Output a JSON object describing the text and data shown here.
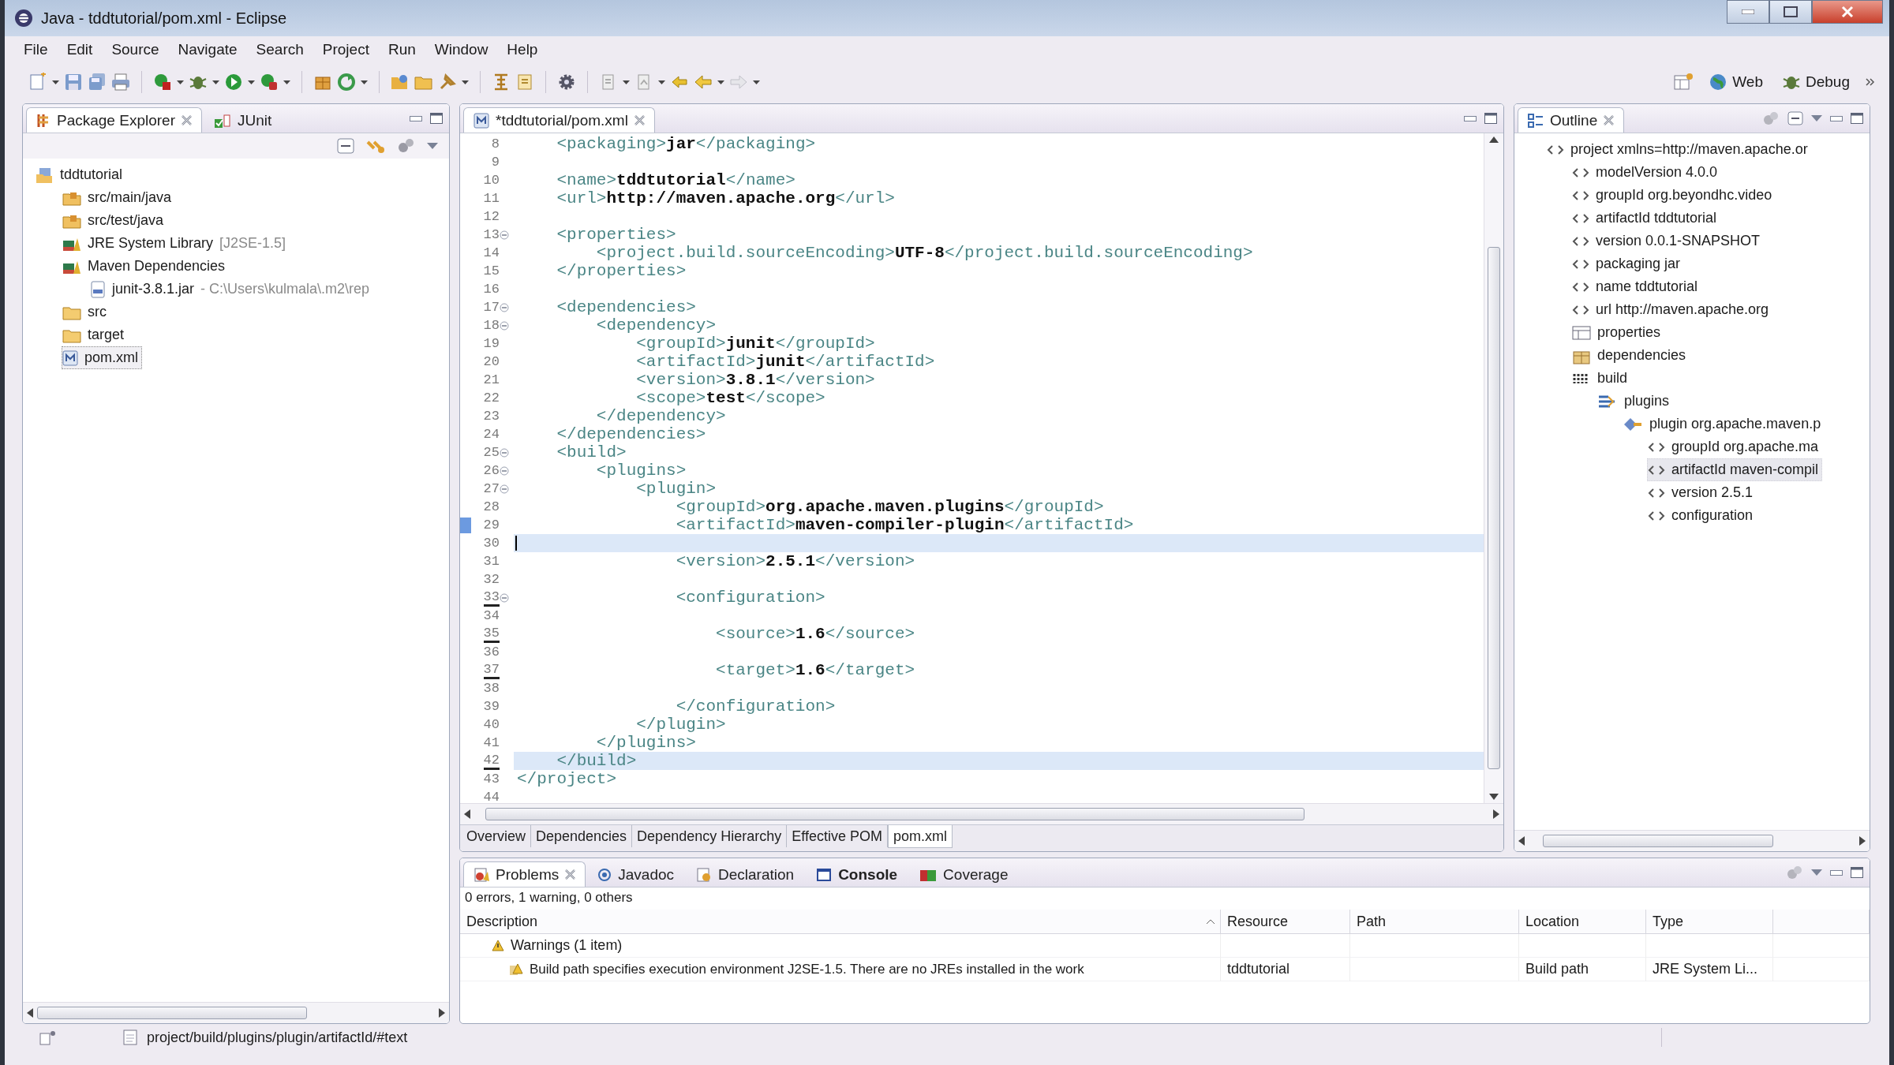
{
  "window": {
    "title": "Java - tddtutorial/pom.xml - Eclipse"
  },
  "menu": [
    "File",
    "Edit",
    "Source",
    "Navigate",
    "Search",
    "Project",
    "Run",
    "Window",
    "Help"
  ],
  "perspectives": [
    {
      "label": "Web",
      "kind": "web"
    },
    {
      "label": "Debug",
      "kind": "debug"
    }
  ],
  "package_explorer": {
    "tabs": [
      {
        "label": "Package Explorer",
        "kind": "packages",
        "selected": true
      },
      {
        "label": "JUnit",
        "kind": "junit",
        "selected": false
      }
    ],
    "tree": [
      {
        "label": "tddtutorial",
        "kind": "project",
        "selected": false,
        "children": [
          {
            "label": "src/main/java",
            "kind": "source-folder",
            "selected": false
          },
          {
            "label": "src/test/java",
            "kind": "source-folder",
            "selected": false
          },
          {
            "label": "JRE System Library",
            "detail": "[J2SE-1.5]",
            "kind": "library",
            "selected": false
          },
          {
            "label": "Maven Dependencies",
            "kind": "library",
            "selected": false,
            "children": [
              {
                "label": "junit-3.8.1.jar",
                "detail": "- C:\\Users\\kulmala\\.m2\\rep",
                "kind": "jar",
                "selected": false
              }
            ]
          },
          {
            "label": "src",
            "kind": "folder",
            "selected": false
          },
          {
            "label": "target",
            "kind": "folder",
            "selected": false
          },
          {
            "label": "pom.xml",
            "kind": "xml",
            "selected": true
          }
        ]
      }
    ]
  },
  "editor": {
    "tabs": [
      {
        "label": "*tddtutorial/pom.xml",
        "selected": true
      }
    ],
    "lines": [
      {
        "number": "8",
        "text": "    <packaging>jar</packaging>",
        "fold": false,
        "marked": false,
        "changed": false,
        "highlighted": false
      },
      {
        "number": "9",
        "fold": false,
        "marked": false,
        "changed": false,
        "highlighted": false
      },
      {
        "number": "10",
        "text": "    <name>tddtutorial</name>",
        "fold": false,
        "marked": false,
        "changed": false,
        "highlighted": false
      },
      {
        "number": "11",
        "text": "    <url>http://maven.apache.org</url>",
        "fold": false,
        "marked": false,
        "changed": false,
        "highlighted": false
      },
      {
        "number": "12",
        "fold": false,
        "marked": false,
        "changed": false,
        "highlighted": false
      },
      {
        "number": "13",
        "text": "    <properties>",
        "fold": true,
        "marked": false,
        "changed": false,
        "highlighted": false
      },
      {
        "number": "14",
        "text": "        <project.build.sourceEncoding>UTF-8</project.build.sourceEncoding>",
        "fold": false,
        "marked": false,
        "changed": false,
        "highlighted": false
      },
      {
        "number": "15",
        "text": "    </properties>",
        "fold": false,
        "marked": false,
        "changed": false,
        "highlighted": false
      },
      {
        "number": "16",
        "fold": false,
        "marked": false,
        "changed": false,
        "highlighted": false
      },
      {
        "number": "17",
        "text": "    <dependencies>",
        "fold": true,
        "marked": false,
        "changed": false,
        "highlighted": false
      },
      {
        "number": "18",
        "text": "        <dependency>",
        "fold": true,
        "marked": false,
        "changed": false,
        "highlighted": false
      },
      {
        "number": "19",
        "text": "            <groupId>junit</groupId>",
        "fold": false,
        "marked": false,
        "changed": false,
        "highlighted": false
      },
      {
        "number": "20",
        "text": "            <artifactId>junit</artifactId>",
        "fold": false,
        "marked": false,
        "changed": false,
        "highlighted": false
      },
      {
        "number": "21",
        "text": "            <version>3.8.1</version>",
        "fold": false,
        "marked": false,
        "changed": false,
        "highlighted": false
      },
      {
        "number": "22",
        "text": "            <scope>test</scope>",
        "fold": false,
        "marked": false,
        "changed": false,
        "highlighted": false
      },
      {
        "number": "23",
        "text": "        </dependency>",
        "fold": false,
        "marked": false,
        "changed": false,
        "highlighted": false
      },
      {
        "number": "24",
        "text": "    </dependencies>",
        "fold": false,
        "marked": false,
        "changed": false,
        "highlighted": false
      },
      {
        "number": "25",
        "text": "    <build>",
        "fold": true,
        "marked": false,
        "changed": false,
        "highlighted": false
      },
      {
        "number": "26",
        "text": "        <plugins>",
        "fold": true,
        "marked": false,
        "changed": false,
        "highlighted": false
      },
      {
        "number": "27",
        "text": "            <plugin>",
        "fold": true,
        "marked": false,
        "changed": false,
        "highlighted": false
      },
      {
        "number": "28",
        "text": "                <groupId>org.apache.maven.plugins</groupId>",
        "fold": false,
        "marked": false,
        "changed": false,
        "highlighted": false
      },
      {
        "number": "29",
        "text": "                <artifactId>maven-compiler-plugin</artifactId>",
        "fold": false,
        "marked": false,
        "changed": true,
        "highlighted": false
      },
      {
        "number": "30",
        "fold": false,
        "marked": false,
        "changed": false,
        "highlighted": true,
        "caret": true
      },
      {
        "number": "31",
        "text": "                <version>2.5.1</version>",
        "fold": false,
        "marked": false,
        "changed": false,
        "highlighted": false
      },
      {
        "number": "32",
        "fold": false,
        "marked": false,
        "changed": false,
        "highlighted": false
      },
      {
        "number": "33",
        "text": "                <configuration>",
        "fold": true,
        "marked": true,
        "changed": false,
        "highlighted": false
      },
      {
        "number": "34",
        "fold": false,
        "marked": false,
        "changed": false,
        "highlighted": false
      },
      {
        "number": "35",
        "text": "                    <source>1.6</source>",
        "fold": false,
        "marked": true,
        "changed": false,
        "highlighted": false
      },
      {
        "number": "36",
        "fold": false,
        "marked": false,
        "changed": false,
        "highlighted": false
      },
      {
        "number": "37",
        "text": "                    <target>1.6</target>",
        "fold": false,
        "marked": true,
        "changed": false,
        "highlighted": false
      },
      {
        "number": "38",
        "fold": false,
        "marked": false,
        "changed": false,
        "highlighted": false
      },
      {
        "number": "39",
        "text": "                </configuration>",
        "fold": false,
        "marked": false,
        "changed": false,
        "highlighted": false
      },
      {
        "number": "40",
        "text": "            </plugin>",
        "fold": false,
        "marked": false,
        "changed": false,
        "highlighted": false
      },
      {
        "number": "41",
        "text": "        </plugins>",
        "fold": false,
        "marked": false,
        "changed": false,
        "highlighted": false
      },
      {
        "number": "42",
        "text": "    </build>",
        "fold": false,
        "marked": true,
        "changed": false,
        "highlighted": true
      },
      {
        "number": "43",
        "text": "</project>",
        "fold": false,
        "marked": false,
        "changed": false,
        "highlighted": false
      },
      {
        "number": "44",
        "fold": false,
        "marked": false,
        "changed": false,
        "highlighted": false
      }
    ],
    "page_tabs": [
      {
        "label": "Overview",
        "selected": false
      },
      {
        "label": "Dependencies",
        "selected": false
      },
      {
        "label": "Dependency Hierarchy",
        "selected": false
      },
      {
        "label": "Effective POM",
        "selected": false
      },
      {
        "label": "pom.xml",
        "selected": true
      }
    ]
  },
  "outline": {
    "tabs": [
      {
        "label": "Outline",
        "selected": true
      }
    ],
    "tree": [
      {
        "label": "project xmlns=http://maven.apache.or",
        "kind": "element",
        "selected": false,
        "children": [
          {
            "label": "modelVersion  4.0.0",
            "kind": "element",
            "selected": false
          },
          {
            "label": "groupId  org.beyondhc.video",
            "kind": "element",
            "selected": false
          },
          {
            "label": "artifactId  tddtutorial",
            "kind": "element",
            "selected": false
          },
          {
            "label": "version  0.0.1-SNAPSHOT",
            "kind": "element",
            "selected": false
          },
          {
            "label": "packaging  jar",
            "kind": "element",
            "selected": false
          },
          {
            "label": "name  tddtutorial",
            "kind": "element",
            "selected": false
          },
          {
            "label": "url  http://maven.apache.org",
            "kind": "element",
            "selected": false
          },
          {
            "label": "properties",
            "kind": "properties",
            "selected": false
          },
          {
            "label": "dependencies",
            "kind": "dependencies",
            "selected": false
          },
          {
            "label": "build",
            "kind": "build",
            "selected": false,
            "children": [
              {
                "label": "plugins",
                "kind": "plugins",
                "selected": false,
                "children": [
                  {
                    "label": "plugin  org.apache.maven.p",
                    "kind": "plugin",
                    "selected": false,
                    "children": [
                      {
                        "label": "groupId  org.apache.ma",
                        "kind": "element",
                        "selected": false
                      },
                      {
                        "label": "artifactId  maven-compil",
                        "kind": "element",
                        "selected": true
                      },
                      {
                        "label": "version  2.5.1",
                        "kind": "element",
                        "selected": false
                      },
                      {
                        "label": "configuration",
                        "kind": "element",
                        "selected": false
                      }
                    ]
                  }
                ]
              }
            ]
          }
        ]
      }
    ]
  },
  "problems": {
    "tabs": [
      {
        "label": "Problems",
        "kind": "problems",
        "selected": true,
        "bold": false
      },
      {
        "label": "Javadoc",
        "kind": "javadoc",
        "selected": false,
        "bold": false
      },
      {
        "label": "Declaration",
        "kind": "declaration",
        "selected": false,
        "bold": false
      },
      {
        "label": "Console",
        "kind": "console",
        "selected": false,
        "bold": true
      },
      {
        "label": "Coverage",
        "kind": "coverage",
        "selected": false,
        "bold": false
      }
    ],
    "summary": "0 errors, 1 warning, 0 others",
    "columns": [
      "Description",
      "Resource",
      "Path",
      "Location",
      "Type"
    ],
    "groups": [
      {
        "label": "Warnings (1 item)",
        "rows": [
          {
            "description": "Build path specifies execution environment J2SE-1.5. There are no JREs installed in the work",
            "resource": "tddtutorial",
            "location": "Build path",
            "type": "JRE System Li..."
          }
        ]
      }
    ]
  },
  "status_bar": {
    "path": "project/build/plugins/plugin/artifactId/#text"
  }
}
